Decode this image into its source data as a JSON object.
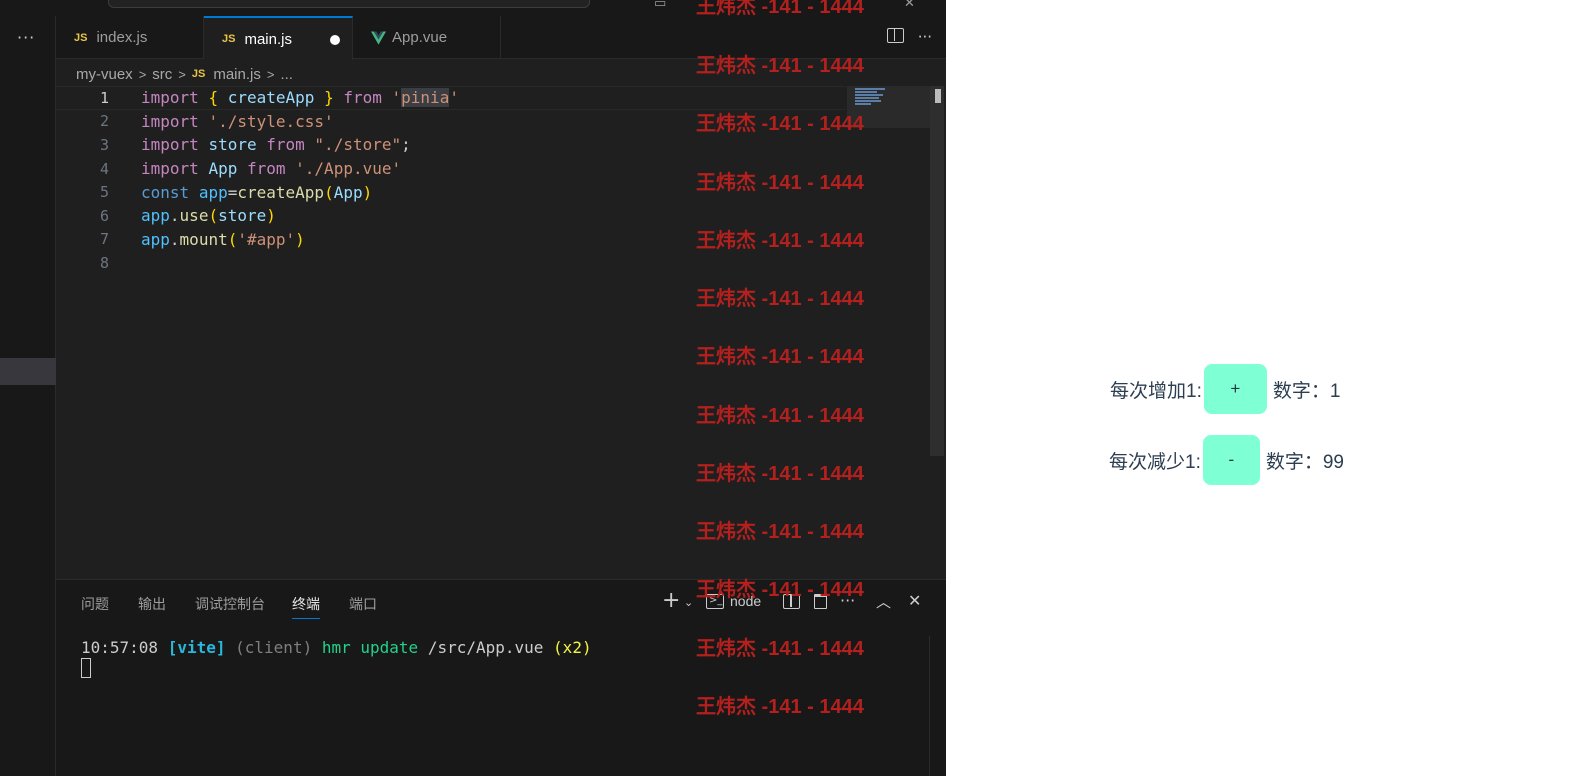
{
  "editor_tabs": [
    {
      "label": "index.js",
      "icon": "JS"
    },
    {
      "label": "main.js",
      "icon": "JS",
      "modified": true
    },
    {
      "label": "App.vue",
      "icon": "vue-icon"
    }
  ],
  "breadcrumb": {
    "parts": [
      "my-vuex",
      "src",
      "main.js",
      "..."
    ],
    "file_icon": "JS"
  },
  "line_numbers": [
    "1",
    "2",
    "3",
    "4",
    "5",
    "6",
    "7",
    "8"
  ],
  "code": {
    "l1": {
      "kw": "import",
      "open": "{",
      "name": "createApp",
      "close": "}",
      "from": "from",
      "q1": "'",
      "mod": "pinia",
      "q2": "'"
    },
    "l2": {
      "kw": "import",
      "str": "'./style.css'"
    },
    "l3": {
      "kw": "import",
      "name": "store",
      "from": "from",
      "str": "\"./store\"",
      "end": ";"
    },
    "l4": {
      "kw": "import",
      "name": "App",
      "from": "from",
      "str": "'./App.vue'"
    },
    "l5": {
      "kw": "const",
      "var": "app",
      "eq": "=",
      "fn": "createApp",
      "open": "(",
      "arg": "App",
      "close": ")"
    },
    "l6": {
      "obj": "app",
      "dot": ".",
      "fn": "use",
      "open": "(",
      "arg": "store",
      "close": ")"
    },
    "l7": {
      "obj": "app",
      "dot": ".",
      "fn": "mount",
      "open": "(",
      "str": "'#app'",
      "close": ")"
    }
  },
  "panel": {
    "tabs": [
      "问题",
      "输出",
      "调试控制台",
      "终端",
      "端口"
    ],
    "active_tab": "终端",
    "terminal_name": "node",
    "terminal_line": {
      "time": "10:57:08",
      "tag": "[vite]",
      "client": "(client)",
      "hmr": "hmr update",
      "path": "/src/App.vue",
      "count": "(x2)"
    }
  },
  "watermark": {
    "text": "王炜杰 -141 - 1444",
    "repeat": 13
  },
  "counter_app": {
    "row1": {
      "label": "每次增加1:",
      "button": "+",
      "result": "数字：1"
    },
    "row2": {
      "label": "每次减少1:",
      "button": "-",
      "result": "数字：99"
    }
  },
  "colors": {
    "accent": "#0078d4",
    "button_bg": "#7fffd4",
    "watermark": "#b3201e",
    "editor_bg": "#1f1f1f"
  }
}
